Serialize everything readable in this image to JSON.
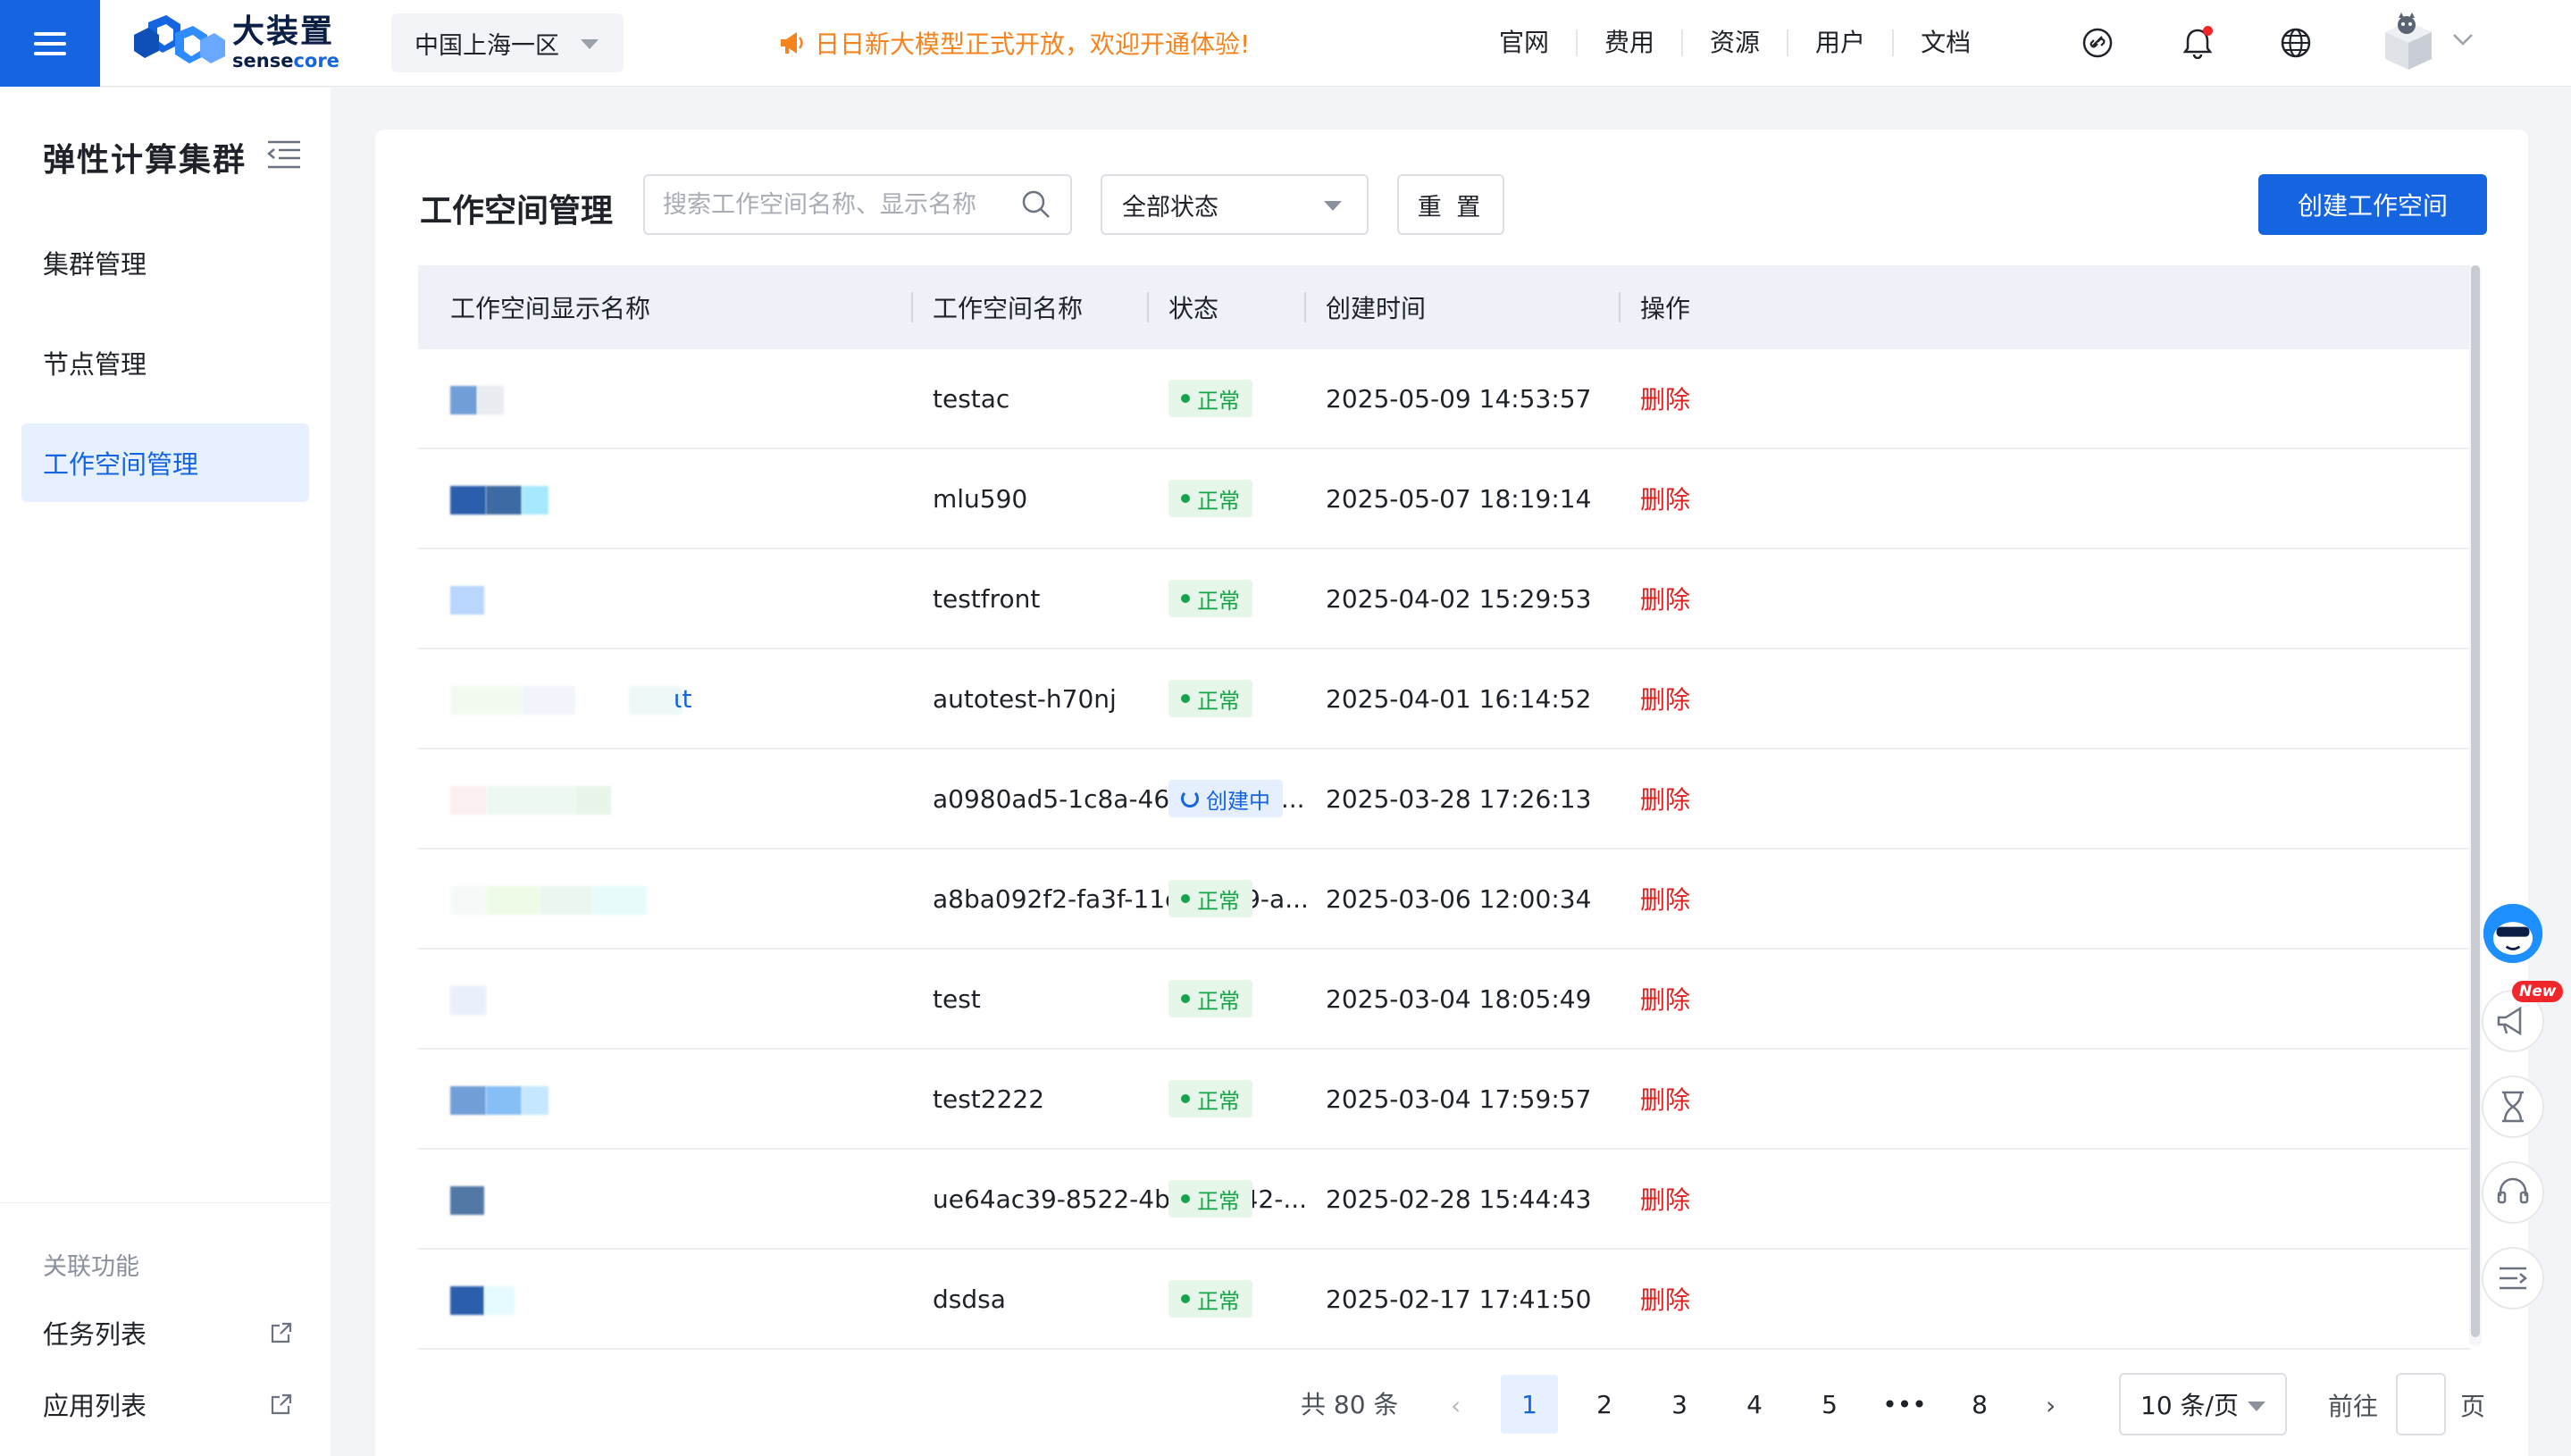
{
  "header": {
    "region": "中国上海一区",
    "announcement": "日日新大模型正式开放，欢迎开通体验!",
    "nav": [
      "官网",
      "费用",
      "资源",
      "用户",
      "文档"
    ],
    "logo": {
      "cn": "大装置",
      "en_a": "sense",
      "en_b": "core"
    }
  },
  "sidebar": {
    "title": "弹性计算集群",
    "items": [
      {
        "label": "集群管理",
        "active": false
      },
      {
        "label": "节点管理",
        "active": false
      },
      {
        "label": "工作空间管理",
        "active": true
      }
    ],
    "related_title": "关联功能",
    "related": [
      {
        "label": "任务列表"
      },
      {
        "label": "应用列表"
      }
    ]
  },
  "main": {
    "title": "工作空间管理",
    "search_placeholder": "搜索工作空间名称、显示名称",
    "status_filter": "全部状态",
    "reset_label": "重 置",
    "create_label": "创建工作空间"
  },
  "table": {
    "columns": [
      "工作空间显示名称",
      "工作空间名称",
      "状态",
      "创建时间",
      "操作"
    ],
    "rows": [
      {
        "display": "",
        "name": "testac",
        "status": "正常",
        "status_kind": "ok",
        "created": "2025-05-09 14:53:57",
        "action": "删除"
      },
      {
        "display": "",
        "name": "mlu590",
        "status": "正常",
        "status_kind": "ok",
        "created": "2025-05-07 18:19:14",
        "action": "删除"
      },
      {
        "display": "",
        "name": "testfront",
        "status": "正常",
        "status_kind": "ok",
        "created": "2025-04-02 15:29:53",
        "action": "删除"
      },
      {
        "display": "ɩt",
        "name": "autotest-h70nj",
        "status": "正常",
        "status_kind": "ok",
        "created": "2025-04-01 16:14:52",
        "action": "删除"
      },
      {
        "display": "",
        "name": "a0980ad5-1c8a-4668-86bc-...",
        "status": "创建中",
        "status_kind": "creating",
        "created": "2025-03-28 17:26:13",
        "action": "删除"
      },
      {
        "display": "",
        "name": "a8ba092f2-fa3f-11ef-9859-a...",
        "status": "正常",
        "status_kind": "ok",
        "created": "2025-03-06 12:00:34",
        "action": "删除"
      },
      {
        "display": "",
        "name": "test",
        "status": "正常",
        "status_kind": "ok",
        "created": "2025-03-04 18:05:49",
        "action": "删除"
      },
      {
        "display": "",
        "name": "test2222",
        "status": "正常",
        "status_kind": "ok",
        "created": "2025-03-04 17:59:57",
        "action": "删除"
      },
      {
        "display": "",
        "name": "ue64ac39-8522-4be5-9142-...",
        "status": "正常",
        "status_kind": "ok",
        "created": "2025-02-28 15:44:43",
        "action": "删除"
      },
      {
        "display": "",
        "name": "dsdsa",
        "status": "正常",
        "status_kind": "ok",
        "created": "2025-02-17 17:41:50",
        "action": "删除"
      }
    ]
  },
  "pagination": {
    "total": "共 80 条",
    "pages": [
      "1",
      "2",
      "3",
      "4",
      "5",
      "•••",
      "8"
    ],
    "current": "1",
    "page_size": "10 条/页",
    "goto_label": "前往",
    "page_suffix": "页"
  },
  "float_tools": {
    "new_badge": "New"
  },
  "colors": {
    "primary": "#1565e0",
    "announce": "#f5841f",
    "danger": "#e0201e",
    "success": "#16a34a"
  }
}
